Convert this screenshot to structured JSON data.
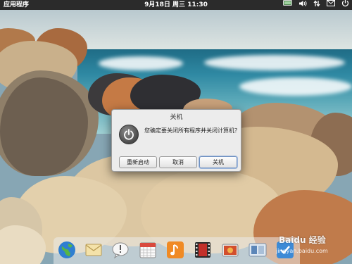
{
  "panel": {
    "applications_label": "应用程序",
    "datetime": "9月18日 周三 11:30",
    "tray_icons": [
      "display-icon",
      "volume-icon",
      "network-icon",
      "mail-icon",
      "power-icon"
    ]
  },
  "dialog": {
    "title": "关机",
    "message": "您确定要关闭所有程序并关闭计算机？",
    "buttons": {
      "restart": "重新启动",
      "cancel": "取消",
      "shutdown": "关机"
    }
  },
  "dock": {
    "icons": [
      "browser-globe-icon",
      "mail-icon",
      "chat-icon",
      "calendar-icon",
      "music-icon",
      "video-icon",
      "photos-icon",
      "workspace-switcher-icon",
      "settings-icon"
    ]
  },
  "watermark": {
    "text": "Baidu 经验",
    "sub": "jingyan.baidu.com"
  },
  "colors": {
    "panel_bg": "#2b2b2b",
    "dialog_bg": "#ececec",
    "sea": "#2f89a3"
  }
}
